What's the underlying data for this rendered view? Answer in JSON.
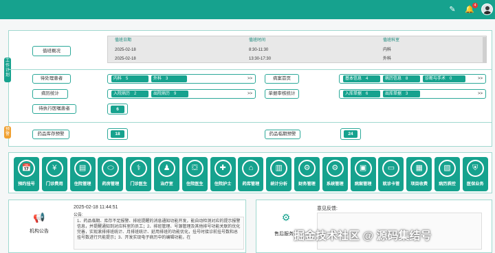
{
  "topbar": {
    "edit_icon": "pencil-icon",
    "bell_icon": "bell-icon",
    "badge_count": "4",
    "avatar": "avatar"
  },
  "work": {
    "vertical_tag": "工作计划",
    "duty_overview": "值班概况",
    "duty_table": {
      "headers": [
        "值班日期",
        "值班时间",
        "值班科室"
      ],
      "rows": [
        [
          "2025-02-18",
          "8:30-11:30",
          "内科"
        ],
        [
          "2025-02-18",
          "13:30-17:30",
          "外科"
        ]
      ]
    },
    "pending_patients": "待处理患者",
    "pending_items": [
      {
        "label": "内科",
        "count": "5"
      },
      {
        "label": "外科",
        "count": "3"
      }
    ],
    "records_home": "病案首页",
    "records_items": [
      {
        "label": "基本信息",
        "count": "4"
      },
      {
        "label": "病历信息",
        "count": "8"
      },
      {
        "label": "诊断与手术",
        "count": "0"
      }
    ],
    "case_stats": "病历统计",
    "case_items": [
      {
        "label": "入院病历",
        "count": "2"
      },
      {
        "label": "出院病历",
        "count": "9"
      }
    ],
    "audit_stats": "单据审核统计",
    "audit_items": [
      {
        "label": "入库单据",
        "count": "6"
      },
      {
        "label": "出库单据",
        "count": "3"
      }
    ],
    "pending_orders": "待执行医嘱患者",
    "pending_orders_count": "6",
    "more": ">>"
  },
  "alert": {
    "vertical_tag": "预警",
    "stock_label": "药品库存预警",
    "stock_count": "18",
    "expiry_label": "药品临期预警",
    "expiry_count": "24"
  },
  "modules": [
    {
      "label": "预约挂号",
      "icon": "calendar-icon",
      "glyph": "📅"
    },
    {
      "label": "门诊费用",
      "icon": "yen-icon",
      "glyph": "¥"
    },
    {
      "label": "住院管理",
      "icon": "document-icon",
      "glyph": "▤"
    },
    {
      "label": "药房管理",
      "icon": "pill-icon",
      "glyph": "⬭"
    },
    {
      "label": "门诊医生",
      "icon": "doctor-icon",
      "glyph": "⚕"
    },
    {
      "label": "治疗室",
      "icon": "user-icon",
      "glyph": "♟"
    },
    {
      "label": "住院医生",
      "icon": "bed-icon",
      "glyph": "⛋"
    },
    {
      "label": "住院护士",
      "icon": "nurse-icon",
      "glyph": "✚"
    },
    {
      "label": "药库管理",
      "icon": "warehouse-icon",
      "glyph": "⌂"
    },
    {
      "label": "统计分析",
      "icon": "chart-icon",
      "glyph": "▥"
    },
    {
      "label": "财务管理",
      "icon": "finance-icon",
      "glyph": "⚙"
    },
    {
      "label": "系统管理",
      "icon": "settings-icon",
      "glyph": "⚙"
    },
    {
      "label": "病案管理",
      "icon": "folder-icon",
      "glyph": "▣"
    },
    {
      "label": "就诊卡管",
      "icon": "card-icon",
      "glyph": "▭"
    },
    {
      "label": "项目收费",
      "icon": "invoice-icon",
      "glyph": "▦"
    },
    {
      "label": "病历质控",
      "icon": "record-icon",
      "glyph": "▧"
    },
    {
      "label": "医保业务",
      "icon": "insurance-icon",
      "glyph": "⛨"
    }
  ],
  "announcement": {
    "title": "机构公告",
    "time": "2025-02-18 11:44:51",
    "heading": "公告:",
    "body": "1、药品临期、库存不足报警、排班提醒的消息通知功能开发，能自动检测对应的提示报警信息，并提醒通知到对应科室的员工；2、排班管理、号源管理及其他排号功能关联的优化完善，实现滚排排班统计、月排班统计、延用排班的功能优化，挂号时接诊前挂号数和总挂号数进行只能提示；3、开发实现电子病历中的编辑功能，在"
  },
  "feedback": {
    "title": "售后服务",
    "label": "意见反馈:"
  },
  "watermark": "掘金技术社区 @ 源码集结号"
}
